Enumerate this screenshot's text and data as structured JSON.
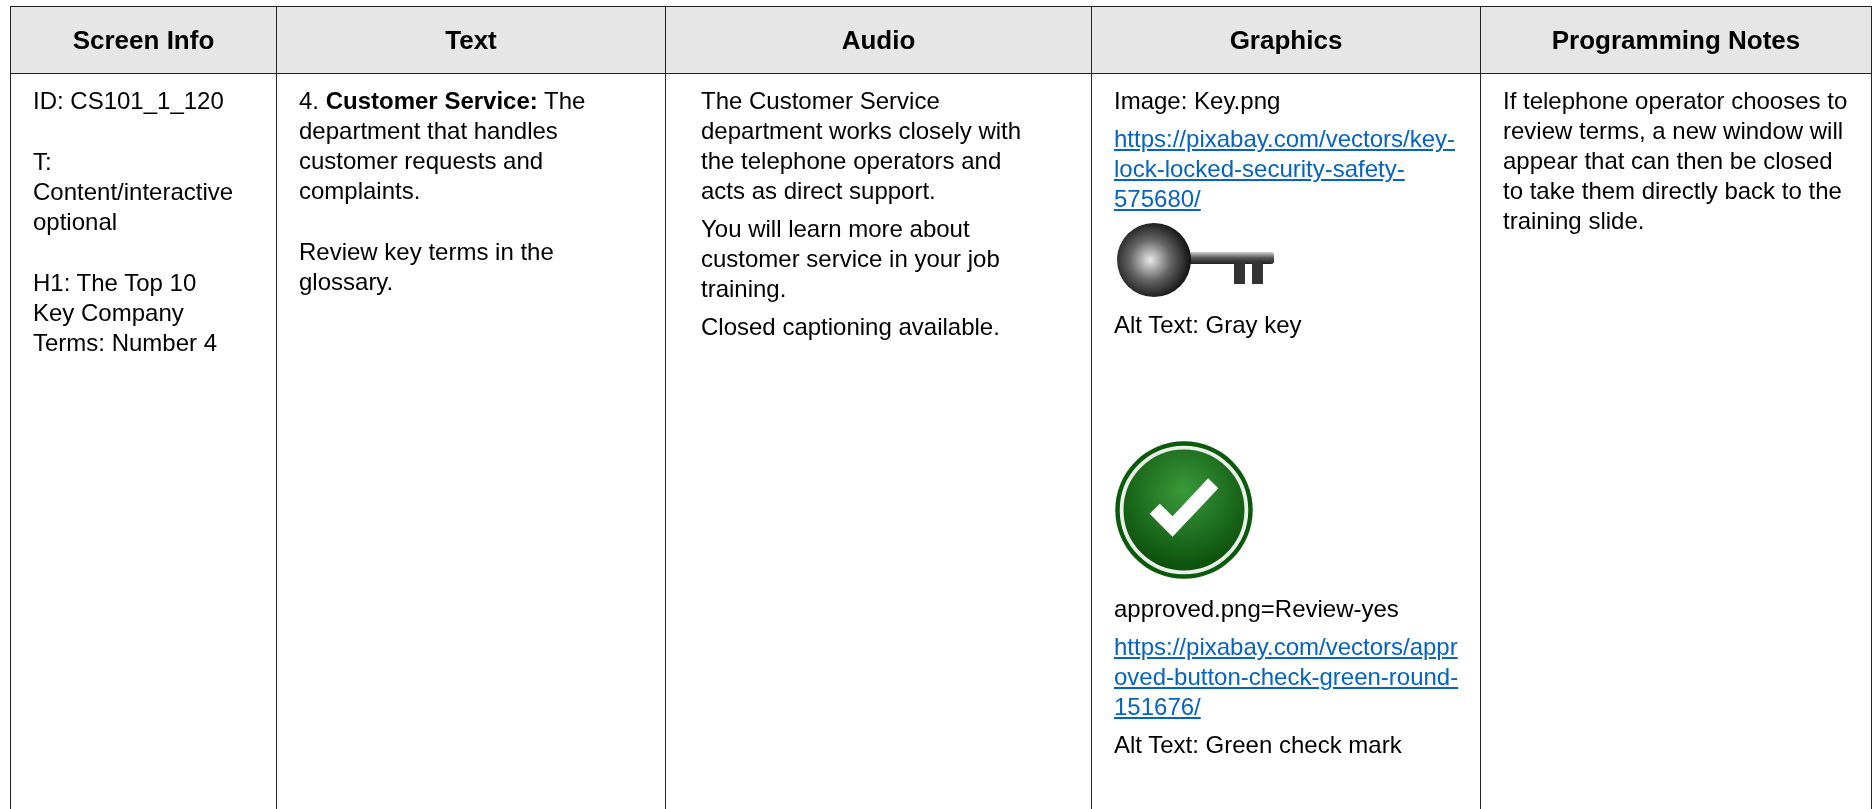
{
  "table": {
    "columns": [
      "Screen Info",
      "Text",
      "Audio",
      "Graphics",
      "Programming Notes"
    ],
    "screen_info": [
      "ID: CS101_1_120",
      "T: Content/interactive optional",
      "H1: The Top 10 Key Company Terms: Number 4"
    ],
    "text": [
      "4. **Customer Service:** The department that handles customer requests and complaints.",
      "Review key terms in the glossary."
    ],
    "audio": [
      "The Customer Service department works closely with the telephone operators and acts as direct support.",
      "You will learn more about customer service in your job training.",
      "Closed captioning available."
    ],
    "graphics": [
      {
        "kind": "text",
        "text": "Image: Key.png"
      },
      {
        "kind": "link",
        "text": "https://pixabay.com/vectors/key-lock-locked-security-safety-575680/"
      },
      {
        "kind": "key-image"
      },
      {
        "kind": "text",
        "text": "Alt Text: Gray key"
      },
      {
        "kind": "check-image"
      },
      {
        "kind": "text",
        "text": "approved.png=Review-yes"
      },
      {
        "kind": "link",
        "text": "https://pixabay.com/vectors/approved-button-check-green-round-151676/"
      },
      {
        "kind": "text",
        "text": "Alt Text: Green check mark"
      }
    ],
    "programming_notes": [
      "If telephone operator chooses to review terms, a new window will appear that can then be closed to take them directly back to the training slide."
    ]
  }
}
